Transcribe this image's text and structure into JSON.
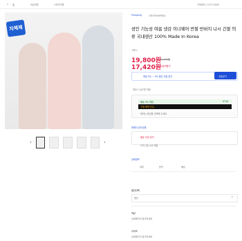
{
  "header": {
    "breadcrumb": [
      "홈",
      "여성의류",
      "스포츠의류"
    ],
    "right_text": "고객센터 | 1577-0000"
  },
  "badge": {
    "text": "자체제"
  },
  "product": {
    "store": "Pumpeng",
    "store_sub": "스포츠PUMPENG",
    "title": "성인 기능성 여름 냉감 이너웨어 반팔 반바지 나시 긴팔 의류 국내생산 100% Made In Korea",
    "rating": "구매 1",
    "price_1": "19,800원",
    "price_1_struck": "22,000원",
    "price_2": "17,420원",
    "price_2_tag": "쿠폰적용가",
    "coupon_label": "최대 3% ~ 5% 할인 쿠폰 받기",
    "coupon_button": "쿠폰받기"
  },
  "shipping": {
    "line1": "최대 1,567원 적립",
    "green_text": "배송 3% 적립",
    "green_value": "9718",
    "dark_text": "구매 혜택 안내",
    "small_note": "원하는 옵션을 선택해 주세요."
  },
  "notice": {
    "label": "판매자 공지사항",
    "text": "배송 안내 공지",
    "subtext": "도착 2일 소요 예정"
  },
  "tabs": [
    "상세정보",
    "리뷰",
    "문의",
    "배송"
  ],
  "option": {
    "section_label": "옵션선택",
    "selected": "옵션",
    "label_a": "색상",
    "desc_a": "상세페이지 참고하세요",
    "label_b": "사이즈",
    "desc_b": "상세페이지 참고하세요"
  },
  "colors": {
    "accent": "#1d4ed8",
    "price_red": "#e11d48"
  }
}
